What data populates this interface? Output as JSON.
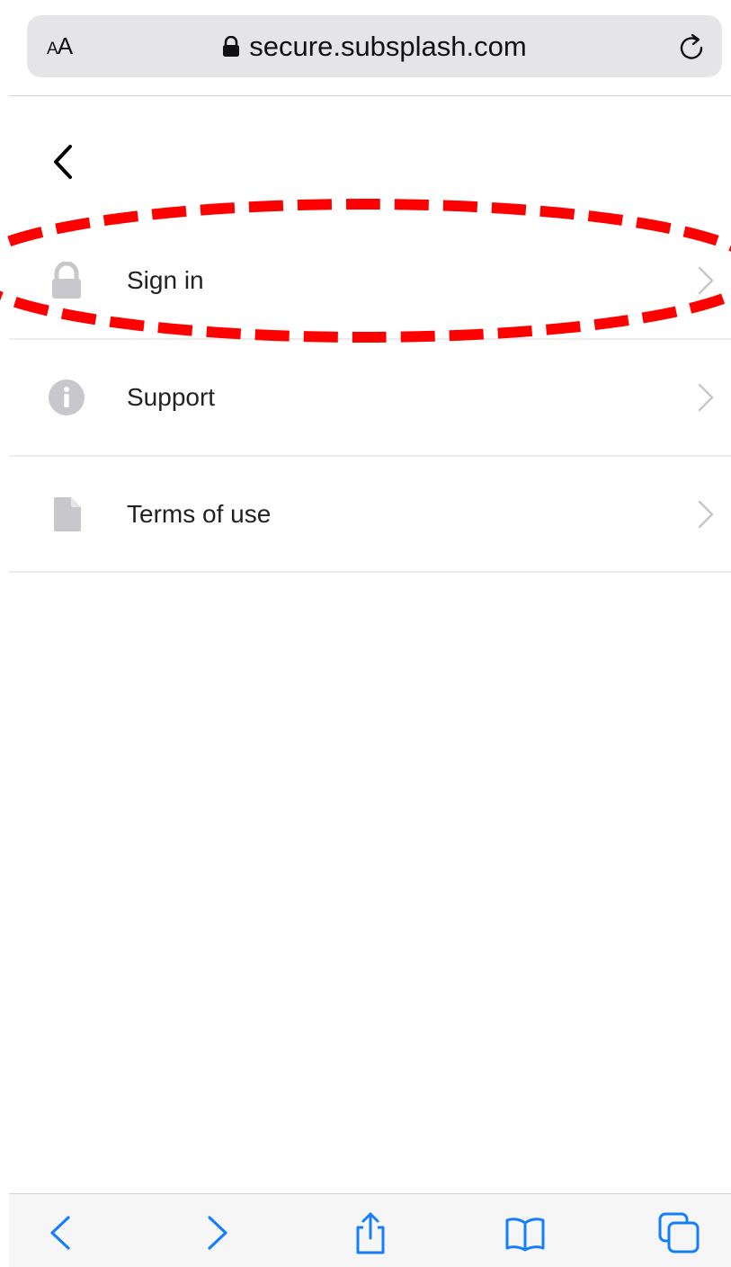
{
  "browser": {
    "text_size_label_small": "A",
    "text_size_label_large": "A",
    "url": "secure.subsplash.com"
  },
  "menu": {
    "items": [
      {
        "label": "Sign in",
        "icon": "lock-icon"
      },
      {
        "label": "Support",
        "icon": "info-icon"
      },
      {
        "label": "Terms of use",
        "icon": "document-icon"
      }
    ]
  },
  "colors": {
    "accent": "#147efb",
    "icon_gray": "#c7c7cc",
    "annotation": "#ff0000"
  }
}
